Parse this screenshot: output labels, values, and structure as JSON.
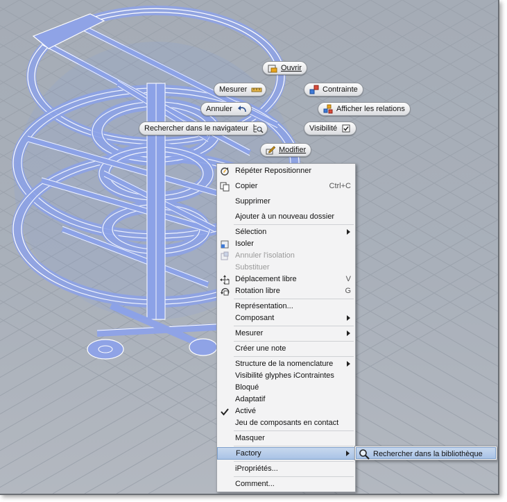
{
  "marking_menu": {
    "open": "Ouvrir",
    "measure": "Mesurer",
    "constraint": "Contrainte",
    "undo": "Annuler",
    "show_relations": "Afficher les relations",
    "find_in_browser": "Rechercher dans le navigateur",
    "visibility": "Visibilité",
    "edit": "Modifier"
  },
  "context_menu": {
    "items": [
      {
        "label": "Répéter Repositionner",
        "icon": "repeat-icon"
      },
      {
        "label": "Copier",
        "shortcut": "Ctrl+C",
        "icon": "copy-icon"
      },
      {
        "label": "Supprimer"
      },
      {
        "label": "Ajouter à un nouveau dossier"
      },
      {
        "label": "Sélection",
        "submenu": true
      },
      {
        "label": "Isoler",
        "icon": "isolate-icon"
      },
      {
        "label": "Annuler l'isolation",
        "disabled": true,
        "icon": "undo-isolate-icon"
      },
      {
        "label": "Substituer",
        "disabled": true
      },
      {
        "label": "Déplacement libre",
        "shortcut": "V",
        "icon": "free-move-icon"
      },
      {
        "label": "Rotation libre",
        "shortcut": "G",
        "icon": "free-rotate-icon"
      },
      {
        "label": "Représentation..."
      },
      {
        "label": "Composant",
        "submenu": true
      },
      {
        "label": "Mesurer",
        "submenu": true
      },
      {
        "label": "Créer une note"
      },
      {
        "label": "Structure de la nomenclature",
        "submenu": true
      },
      {
        "label": "Visibilité glyphes iContraintes"
      },
      {
        "label": "Bloqué"
      },
      {
        "label": "Adaptatif"
      },
      {
        "label": "Activé",
        "checked": true
      },
      {
        "label": "Jeu de composants en contact"
      },
      {
        "label": "Masquer"
      },
      {
        "label": "Factory",
        "submenu": true,
        "highlighted": true
      },
      {
        "label": "iPropriétés..."
      },
      {
        "label": "Comment..."
      }
    ]
  },
  "submenu": {
    "item": "Rechercher dans la bibliothèque",
    "icon": "magnifier-icon"
  },
  "colors": {
    "background": "#a9b0ba",
    "model_stroke": "#ffffff",
    "model_fill": "#8fa3e6",
    "highlight": "#b8cdea"
  }
}
